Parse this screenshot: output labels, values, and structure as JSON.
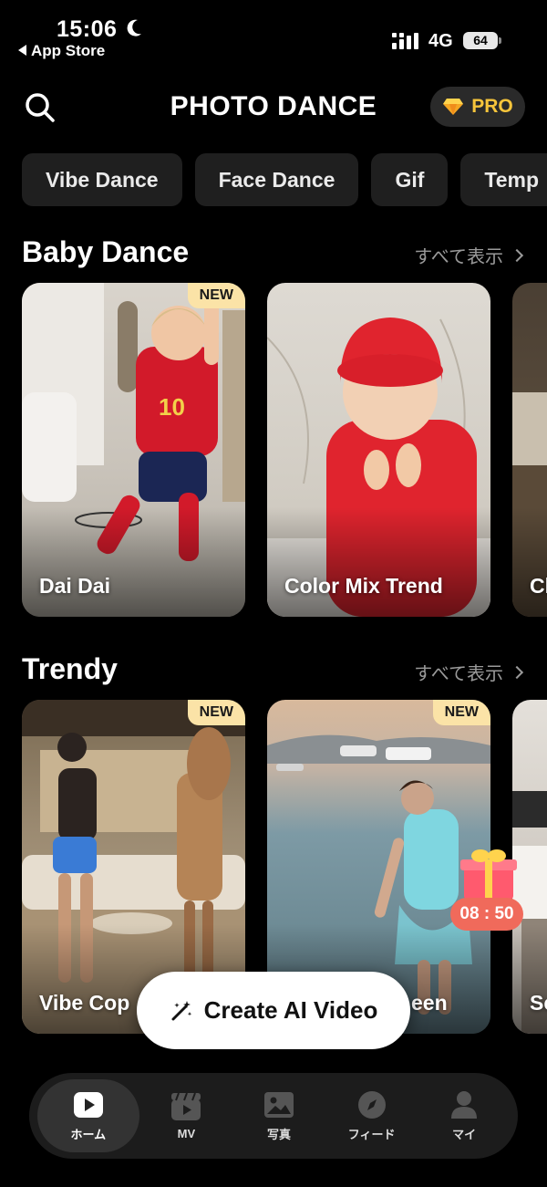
{
  "status_bar": {
    "time": "15:06",
    "back_label": "App Store",
    "network": "4G",
    "battery": "64"
  },
  "header": {
    "title": "PHOTO DANCE",
    "pro_label": "PRO"
  },
  "chips": [
    "Vibe Dance",
    "Face Dance",
    "Gif",
    "Temp"
  ],
  "sections": [
    {
      "title": "Baby Dance",
      "see_all": "すべて表示",
      "cards": [
        {
          "label": "Dai Dai",
          "badge": "NEW"
        },
        {
          "label": "Color Mix Trend",
          "badge": ""
        },
        {
          "label": "Cl",
          "badge": ""
        }
      ]
    },
    {
      "title": "Trendy",
      "see_all": "すべて表示",
      "cards": [
        {
          "label": "Vibe Cop",
          "badge": "NEW"
        },
        {
          "label": "een",
          "badge": "NEW"
        },
        {
          "label": "Sc",
          "badge": ""
        }
      ]
    }
  ],
  "timer": "08 : 50",
  "create_button": "Create AI Video",
  "nav": [
    {
      "label": "ホーム",
      "icon": "play-icon"
    },
    {
      "label": "MV",
      "icon": "clapperboard-icon"
    },
    {
      "label": "写真",
      "icon": "image-icon"
    },
    {
      "label": "フィード",
      "icon": "compass-icon"
    },
    {
      "label": "マイ",
      "icon": "person-icon"
    }
  ],
  "colors": {
    "background": "#000000",
    "pro_gold": "#f7c53b",
    "badge_bg": "#fbe3a7",
    "timer_bg": "#f06a5b"
  }
}
